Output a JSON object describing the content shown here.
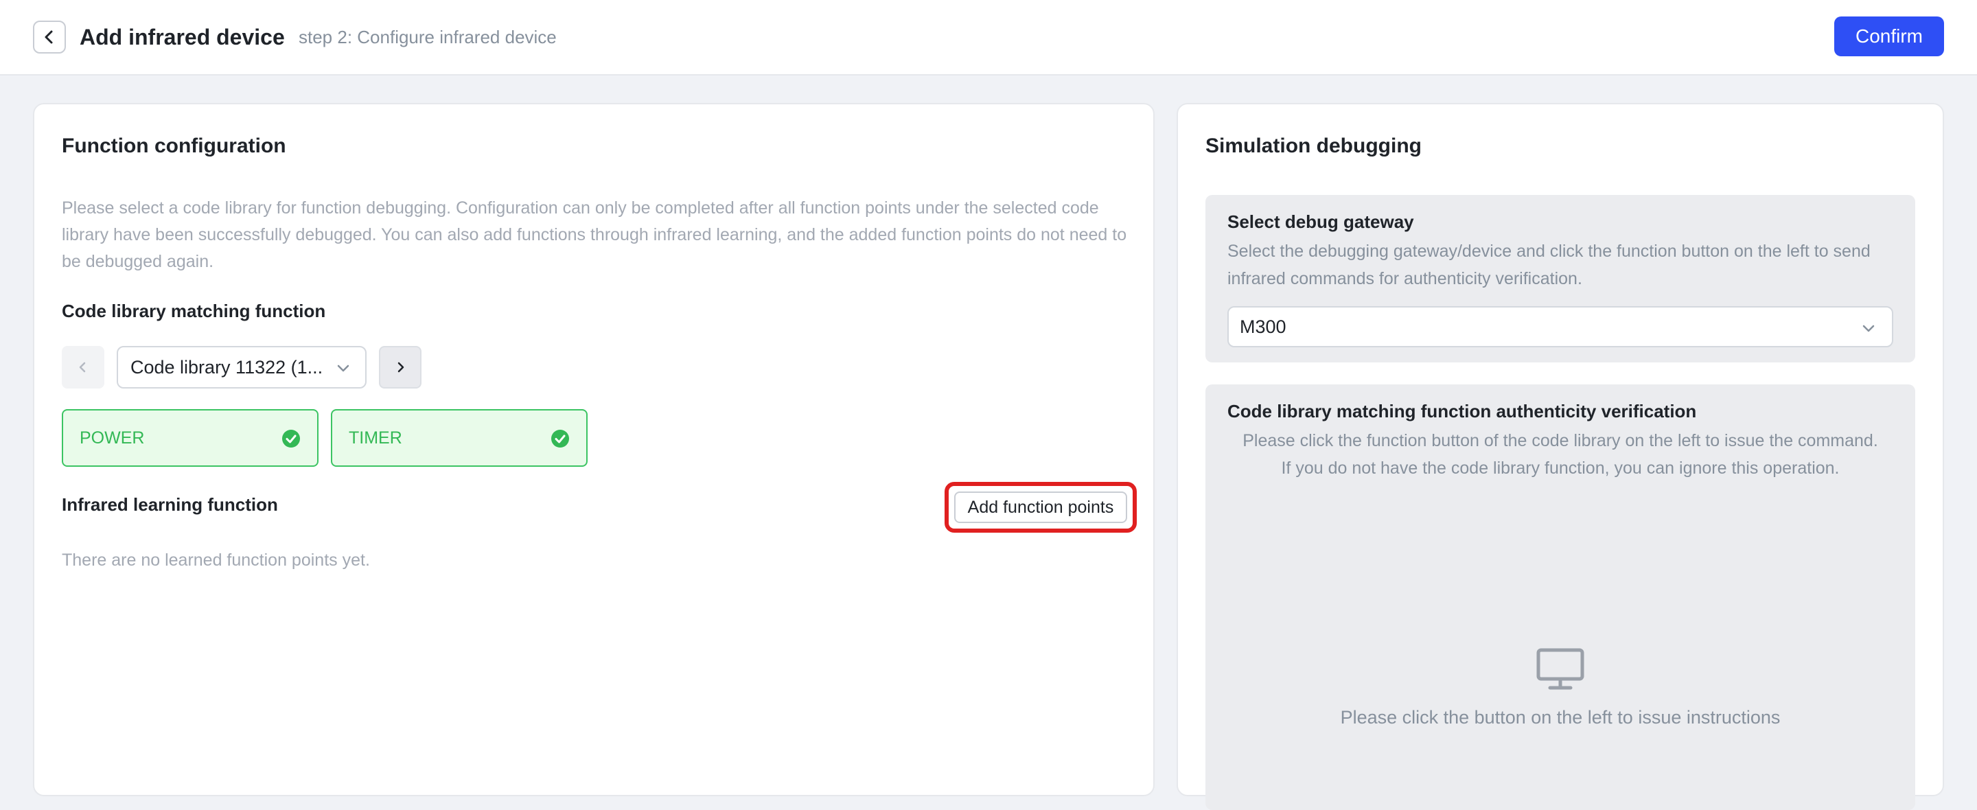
{
  "header": {
    "title": "Add infrared device",
    "subtitle": "step 2: Configure infrared device",
    "confirm_label": "Confirm"
  },
  "function_config": {
    "title": "Function configuration",
    "description": "Please select a code library for function debugging. Configuration can only be completed after all function points under the selected code library have been successfully debugged. You can also add functions through infrared learning, and the added function points do not need to be debugged again.",
    "code_library_label": "Code library matching function",
    "library_select_value": "Code library 11322 (1...",
    "functions": [
      {
        "label": "POWER",
        "status": "debugged"
      },
      {
        "label": "TIMER",
        "status": "debugged"
      }
    ],
    "infrared_learning_label": "Infrared learning function",
    "add_function_points_label": "Add function points",
    "empty_learned_text": "There are no learned function points yet."
  },
  "simulation": {
    "title": "Simulation debugging",
    "gateway": {
      "title": "Select debug gateway",
      "description": "Select the debugging gateway/device and click the function button on the left to send infrared commands for authenticity verification.",
      "selected_value": "M300"
    },
    "verification": {
      "title": "Code library matching function authenticity verification",
      "line1": "Please click the function button of the code library on the left to issue the command.",
      "line2": "If you do not have the code library function, you can ignore this operation.",
      "empty_text": "Please click the button on the left to issue instructions"
    }
  },
  "colors": {
    "accent": "#2e4ff5",
    "success": "#33b855",
    "success_bg": "#e9fbea",
    "highlight": "#e02020"
  },
  "icons": {
    "back": "chevron-left-icon",
    "dropdown": "chevron-down-icon",
    "prev": "chevron-left-icon",
    "next": "chevron-right-icon",
    "debugged": "check-circle-icon",
    "monitor": "monitor-icon"
  }
}
